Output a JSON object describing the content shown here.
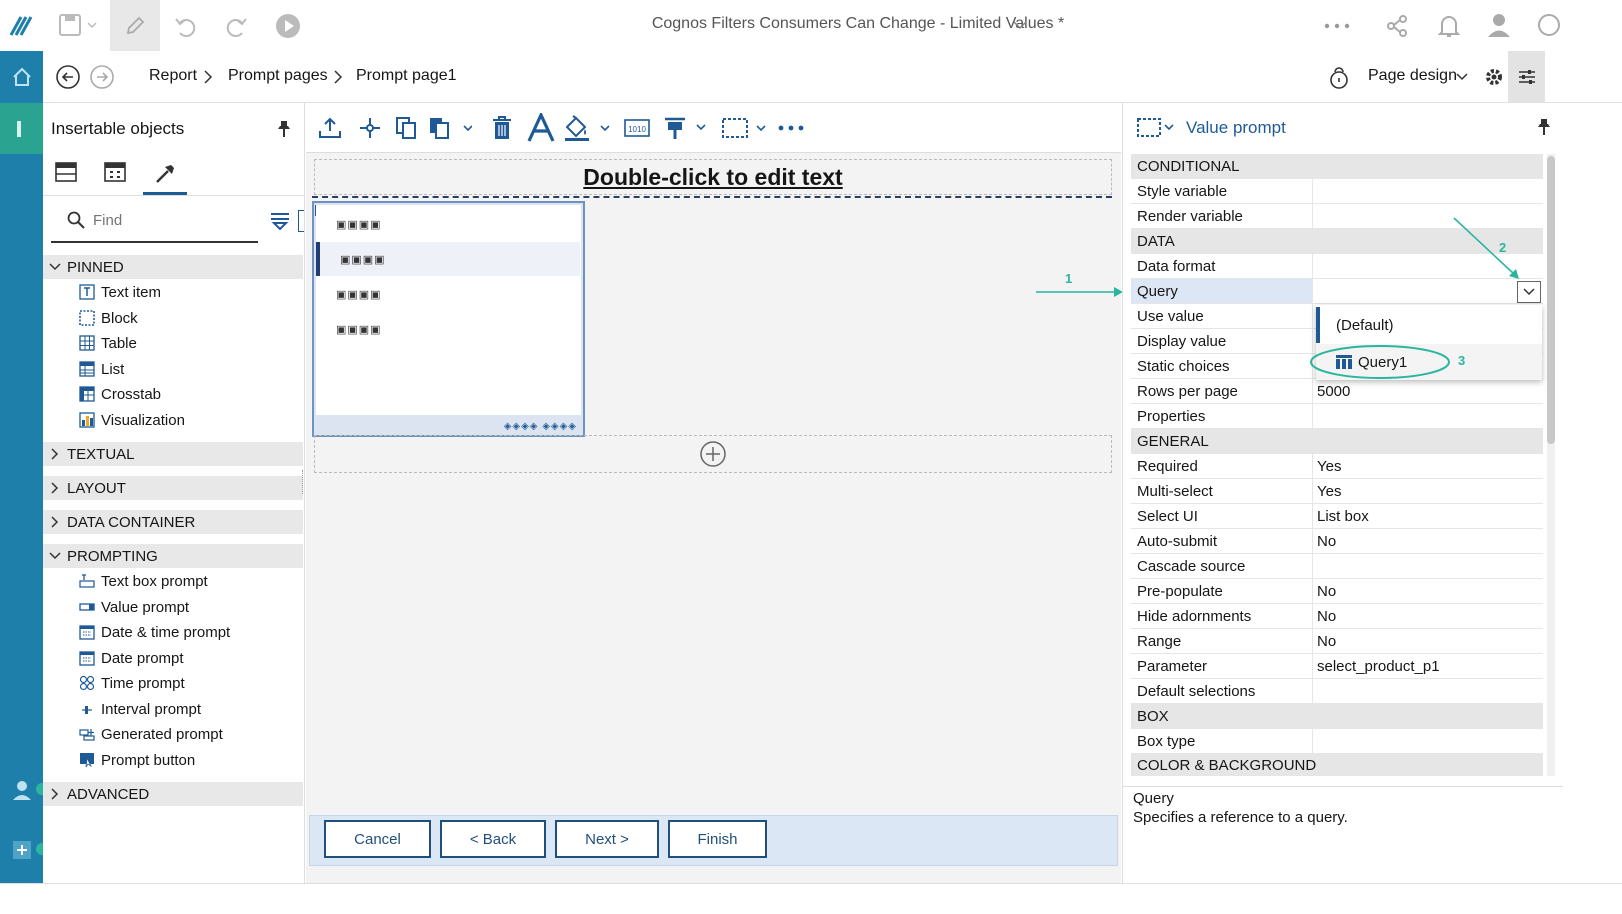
{
  "app": {
    "title": "Cognos Filters Consumers Can Change - Limited Values *"
  },
  "nav": {
    "breadcrumb": [
      "Report",
      "Prompt pages",
      "Prompt page1"
    ],
    "view_mode": "Page design"
  },
  "left_panel": {
    "title": "Insertable objects",
    "search_placeholder": "Find",
    "groups": {
      "pinned": "PINNED",
      "textual": "TEXTUAL",
      "layout": "LAYOUT",
      "data_container": "DATA CONTAINER",
      "prompting": "PROMPTING",
      "advanced": "ADVANCED"
    },
    "pinned_items": [
      "Text item",
      "Block",
      "Table",
      "List",
      "Crosstab",
      "Visualization"
    ],
    "prompting_items": [
      "Text box prompt",
      "Value prompt",
      "Date & time prompt",
      "Date prompt",
      "Time prompt",
      "Interval prompt",
      "Generated prompt",
      "Prompt button"
    ]
  },
  "canvas": {
    "header_text": "Double-click to edit text",
    "listbox_rows": [
      "▣▣▣▣",
      "▣▣▣▣",
      "▣▣▣▣",
      "▣▣▣▣"
    ],
    "listbox_footer": "◈◈◈◈ ◈◈◈◈",
    "buttons": {
      "cancel": "Cancel",
      "back": "< Back",
      "next": "Next >",
      "finish": "Finish"
    }
  },
  "right_panel": {
    "object_title": "Value prompt",
    "properties": {
      "conditional": "CONDITIONAL",
      "style_variable": "Style variable",
      "render_variable": "Render variable",
      "data": "DATA",
      "data_format": "Data format",
      "query": "Query",
      "use_value": "Use value",
      "display_value": "Display value",
      "static_choices": "Static choices",
      "rows_per_page": "Rows per page",
      "rows_per_page_value": "5000",
      "properties": "Properties",
      "general": "GENERAL",
      "required": "Required",
      "required_value": "Yes",
      "multi_select": "Multi-select",
      "multi_select_value": "Yes",
      "select_ui": "Select UI",
      "select_ui_value": "List box",
      "auto_submit": "Auto-submit",
      "auto_submit_value": "No",
      "cascade_source": "Cascade source",
      "pre_populate": "Pre-populate",
      "pre_populate_value": "No",
      "hide_adornments": "Hide adornments",
      "hide_adornments_value": "No",
      "range": "Range",
      "range_value": "No",
      "parameter": "Parameter",
      "parameter_value": "select_product_p1",
      "default_selections": "Default selections",
      "box": "BOX",
      "box_type": "Box type",
      "color_background": "COLOR & BACKGROUND"
    },
    "dropdown_options": [
      "(Default)",
      "Query1"
    ],
    "description": {
      "title": "Query",
      "text": "Specifies a reference to a query."
    }
  },
  "annotations": {
    "step1": "1",
    "step2": "2",
    "step3": "3",
    "color": "#2bb5a0"
  },
  "colors": {
    "rail": "#1e7faa",
    "accent": "#1f5a96",
    "annotation": "#2bb5a0"
  }
}
